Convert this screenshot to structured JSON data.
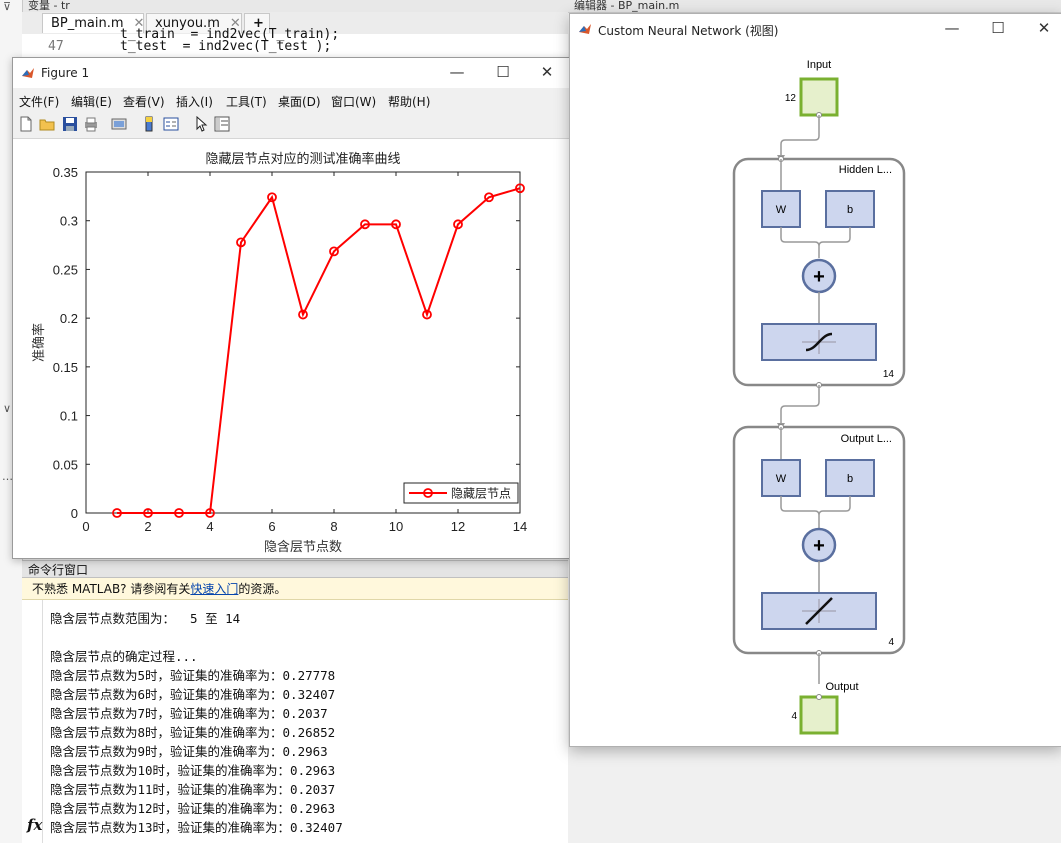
{
  "background": {
    "variables_title": "变量 - tr",
    "editor_title": "编辑器 - BP_main.m",
    "tabs": [
      {
        "label": "BP_main.m"
      },
      {
        "label": "xunyou.m"
      },
      {
        "label": "+"
      }
    ],
    "code_lines": [
      {
        "num": "",
        "text": "t_train  = ind2vec(T_train);"
      },
      {
        "num": "47",
        "text": "t_test  = ind2vec(T_test );"
      }
    ]
  },
  "figure1": {
    "title": "Figure 1",
    "menu": [
      "文件(F)",
      "编辑(E)",
      "查看(V)",
      "插入(I)",
      "工具(T)",
      "桌面(D)",
      "窗口(W)",
      "帮助(H)"
    ],
    "toolbar_icons": [
      "new-icon",
      "open-icon",
      "save-icon",
      "print-icon",
      "link-icon",
      "colorbar-icon",
      "legend-icon",
      "pointer-icon",
      "property-icon"
    ],
    "controls": {
      "minimize": "—",
      "maximize": "☐",
      "close": "✕"
    }
  },
  "chart_data": {
    "type": "line",
    "title": "隐藏层节点对应的测试准确率曲线",
    "xlabel": "隐含层节点数",
    "ylabel": "准确率",
    "xlim": [
      0,
      14
    ],
    "ylim": [
      0,
      0.35
    ],
    "xticks": [
      0,
      2,
      4,
      6,
      8,
      10,
      12,
      14
    ],
    "yticks": [
      0,
      0.05,
      0.1,
      0.15,
      0.2,
      0.25,
      0.3,
      0.35
    ],
    "ytick_labels": [
      "0",
      "0.05",
      "0.1",
      "0.15",
      "0.2",
      "0.25",
      "0.3",
      "0.35"
    ],
    "grid": false,
    "legend_position": "bottom-right",
    "series": [
      {
        "name": "隐藏层节点",
        "color": "#ff0000",
        "marker": "circle",
        "x": [
          1,
          2,
          3,
          4,
          5,
          6,
          7,
          8,
          9,
          10,
          11,
          12,
          13,
          14
        ],
        "y": [
          0,
          0,
          0,
          0,
          0.27778,
          0.32407,
          0.2037,
          0.26852,
          0.2963,
          0.2963,
          0.2037,
          0.2963,
          0.32407,
          0.33333
        ]
      }
    ]
  },
  "command_window": {
    "header": "命令行窗口",
    "hint_prefix": "不熟悉 MATLAB? 请参阅有关",
    "hint_link": "快速入门",
    "hint_suffix": "的资源。",
    "lines": [
      "隐含层节点数范围为：  5 至 14",
      "",
      "隐含层节点的确定过程...",
      "隐含层节点数为5时，验证集的准确率为：0.27778",
      "隐含层节点数为6时，验证集的准确率为：0.32407",
      "隐含层节点数为7时，验证集的准确率为：0.2037",
      "隐含层节点数为8时，验证集的准确率为：0.26852",
      "隐含层节点数为9时，验证集的准确率为：0.2963",
      "隐含层节点数为10时，验证集的准确率为：0.2963",
      "隐含层节点数为11时，验证集的准确率为：0.2037",
      "隐含层节点数为12时，验证集的准确率为：0.2963",
      "隐含层节点数为13时，验证集的准确率为：0.32407"
    ],
    "fx": "fx"
  },
  "nn_window": {
    "title": "Custom Neural Network (视图)",
    "controls": {
      "minimize": "—",
      "maximize": "☐",
      "close": "✕"
    },
    "input_label": "Input",
    "input_size": "12",
    "hidden_label": "Hidden L...",
    "hidden_size": "14",
    "output_layer_label": "Output L...",
    "output_layer_size": "4",
    "output_label": "Output",
    "output_size": "4",
    "w_label": "W",
    "b_label": "b",
    "plus": "+"
  },
  "colors": {
    "series_red": "#ff0000",
    "nn_box_fill": "#cdd6ee",
    "nn_box_stroke": "#5a6f9f",
    "nn_io_fill": "#e6f0cc",
    "nn_io_stroke": "#7ab030",
    "hint_bg": "#fff8dc"
  }
}
